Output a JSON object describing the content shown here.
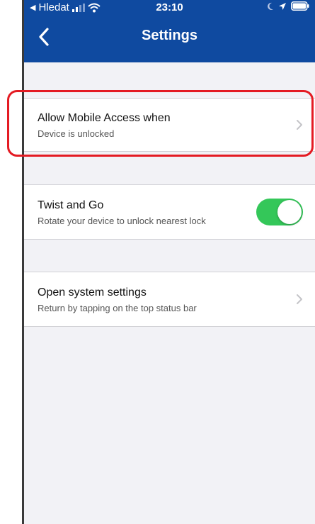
{
  "status_bar": {
    "carrier": "Hledat",
    "time": "23:10",
    "back_arrow": "◀"
  },
  "nav": {
    "title": "Settings",
    "back_icon": "chevron-left-icon"
  },
  "settings": {
    "mobile_access": {
      "title": "Allow Mobile Access when",
      "subtitle": "Device is unlocked",
      "icon": "chevron-right-icon"
    },
    "twist_and_go": {
      "title": "Twist and Go",
      "subtitle": "Rotate your device to unlock nearest lock",
      "enabled": true
    },
    "open_system_settings": {
      "title": "Open system settings",
      "subtitle": "Return by tapping on the top status bar",
      "icon": "chevron-right-icon"
    }
  },
  "colors": {
    "nav_bg": "#0f4aa0",
    "page_bg": "#f2f2f6",
    "toggle_on": "#34c759",
    "highlight": "#e41b23"
  }
}
